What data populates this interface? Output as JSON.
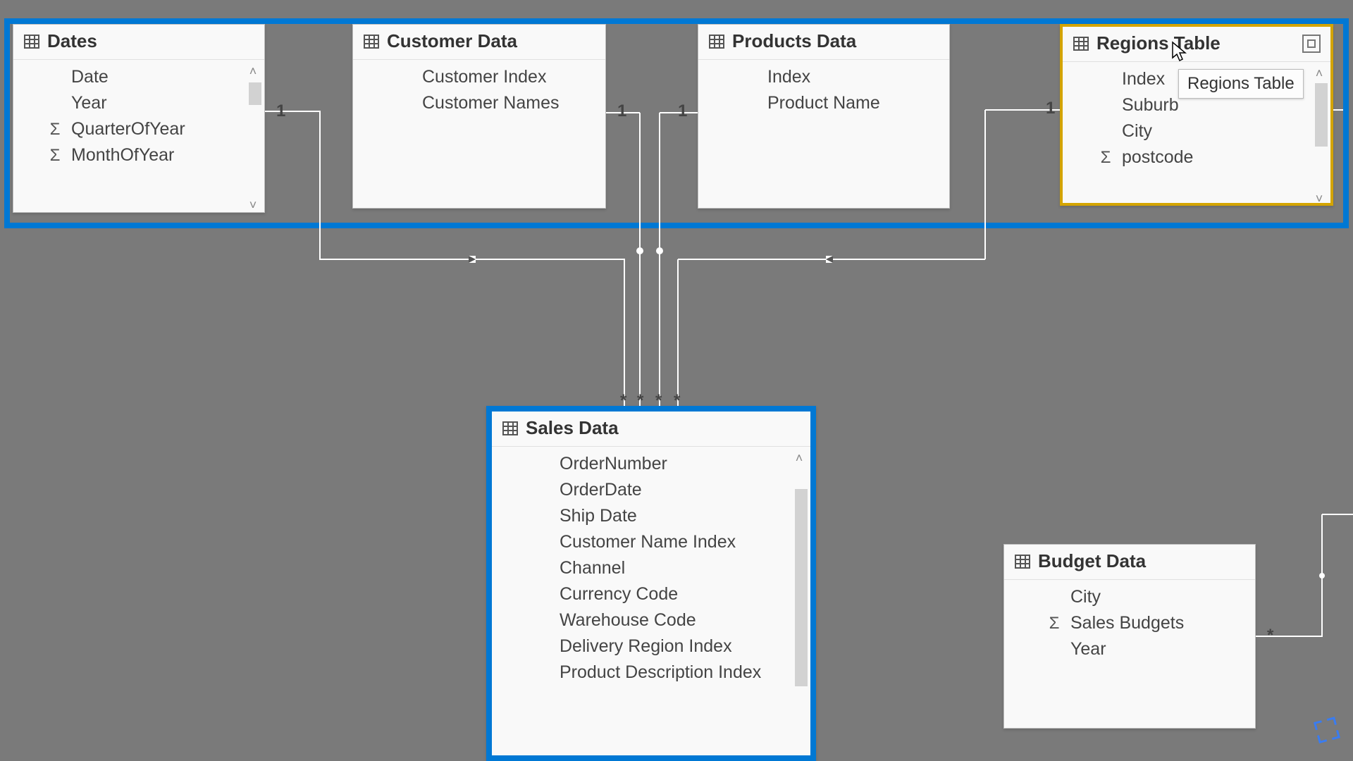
{
  "tables": {
    "dates": {
      "title": "Dates",
      "fields": [
        {
          "name": "Date",
          "sigma": false
        },
        {
          "name": "Year",
          "sigma": false
        },
        {
          "name": "QuarterOfYear",
          "sigma": true
        },
        {
          "name": "MonthOfYear",
          "sigma": true
        }
      ]
    },
    "customer": {
      "title": "Customer Data",
      "fields": [
        {
          "name": "Customer Index",
          "sigma": false
        },
        {
          "name": "Customer Names",
          "sigma": false
        }
      ]
    },
    "products": {
      "title": "Products Data",
      "fields": [
        {
          "name": "Index",
          "sigma": false
        },
        {
          "name": "Product Name",
          "sigma": false
        }
      ]
    },
    "regions": {
      "title": "Regions Table",
      "tooltip": "Regions Table",
      "fields": [
        {
          "name": "Index",
          "sigma": false
        },
        {
          "name": "Suburb",
          "sigma": false
        },
        {
          "name": "City",
          "sigma": false
        },
        {
          "name": "postcode",
          "sigma": true
        }
      ]
    },
    "sales": {
      "title": "Sales Data",
      "fields": [
        {
          "name": "OrderNumber",
          "sigma": false
        },
        {
          "name": "OrderDate",
          "sigma": false
        },
        {
          "name": "Ship Date",
          "sigma": false
        },
        {
          "name": "Customer Name Index",
          "sigma": false
        },
        {
          "name": "Channel",
          "sigma": false
        },
        {
          "name": "Currency Code",
          "sigma": false
        },
        {
          "name": "Warehouse Code",
          "sigma": false
        },
        {
          "name": "Delivery Region Index",
          "sigma": false
        },
        {
          "name": "Product Description Index",
          "sigma": false
        }
      ]
    },
    "budget": {
      "title": "Budget Data",
      "fields": [
        {
          "name": "City",
          "sigma": false
        },
        {
          "name": "Sales Budgets",
          "sigma": true
        },
        {
          "name": "Year",
          "sigma": false
        }
      ]
    }
  },
  "relationships": {
    "cardinality_one": "1",
    "cardinality_many": "*"
  }
}
